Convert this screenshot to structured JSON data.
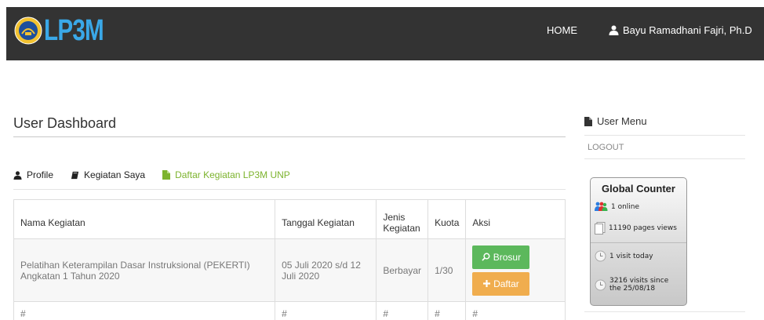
{
  "header": {
    "brand": "LP3M",
    "nav_home": "HOME",
    "user_name": "Bayu Ramadhani Fajri, Ph.D",
    "brand_color": "#3aa8e8",
    "background_color": "#333333"
  },
  "main": {
    "title": "User Dashboard",
    "tabs": [
      {
        "label": "Profile",
        "icon": "user-icon"
      },
      {
        "label": "Kegiatan Saya",
        "icon": "book-icon"
      },
      {
        "label": "Daftar Kegiatan LP3M UNP",
        "icon": "file-icon",
        "color": "#7cb32d"
      }
    ],
    "table": {
      "headers": [
        "Nama Kegiatan",
        "Tanggal Kegiatan",
        "Jenis Kegiatan",
        "Kuota",
        "Aksi"
      ],
      "rows": [
        {
          "nama": "Pelatihan Keterampilan Dasar Instruksional (PEKERTI) Angkatan 1 Tahun 2020",
          "tanggal": "05 Juli 2020 s/d 12 Juli 2020",
          "jenis": "Berbayar",
          "kuota": "1/30",
          "btn_brosur": "Brosur",
          "btn_daftar": "Daftar"
        },
        {
          "nama": "#",
          "tanggal": "#",
          "jenis": "#",
          "kuota": "#",
          "aksi": "#"
        }
      ]
    }
  },
  "sidebar": {
    "title": "User Menu",
    "logout": "LOGOUT",
    "counter": {
      "title": "Global Counter",
      "online": "1 online",
      "page_views": "11190 pages views",
      "visits_today": "1 visit today",
      "visits_since_1": "3216 visits since",
      "visits_since_2": "the 25/08/18"
    }
  }
}
